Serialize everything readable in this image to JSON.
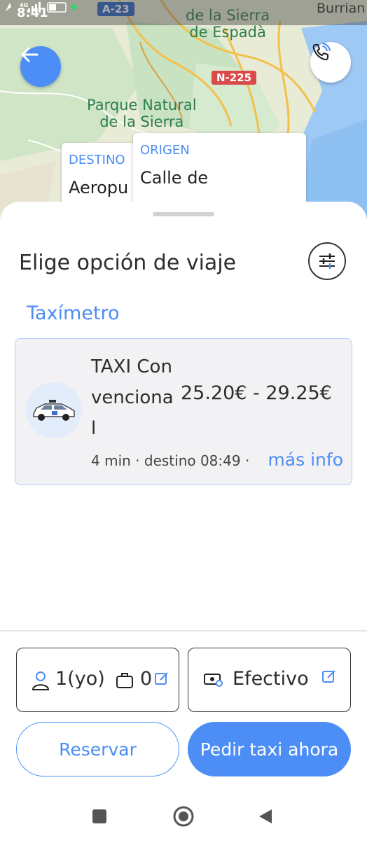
{
  "status_bar": {
    "time": "8:41"
  },
  "map": {
    "roads": [
      "A-23",
      "N-225"
    ],
    "labels": {
      "sierra_espada": [
        "de la Sierra",
        "de Espadà"
      ],
      "parque": [
        "Parque Natural",
        "de la Sierra"
      ],
      "town": "Burrian"
    },
    "destination_card": {
      "label": "DESTINO",
      "value": "Aeropu"
    },
    "origin_card": {
      "label": "ORIGEN",
      "value": "Calle de"
    }
  },
  "sheet": {
    "title": "Elige opción de viaje",
    "section": "Taxímetro",
    "option": {
      "name": "TAXI Convencional",
      "price": "25.20€ - 29.25€",
      "meta": "4 min · destino 08:49 ·",
      "more": "más info"
    },
    "passengers": "1(yo)",
    "luggage": "0",
    "payment": "Efectivo",
    "reserve_button": "Reservar",
    "order_button": "Pedir taxi ahora"
  },
  "icons": {
    "back": "arrow-left-icon",
    "call": "phone-call-icon",
    "filter": "sliders-icon",
    "car": "taxi-car-icon",
    "person": "person-icon",
    "luggage": "suitcase-icon",
    "edit": "edit-icon",
    "cash": "cash-icon"
  },
  "colors": {
    "accent": "#4c8df6",
    "card_bg": "#f2f2f4"
  }
}
